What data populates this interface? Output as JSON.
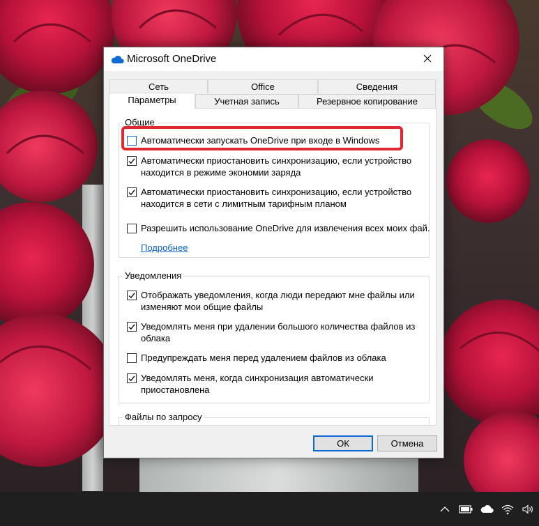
{
  "dialog": {
    "title": "Microsoft OneDrive",
    "tabs_back": [
      "Сеть",
      "Office",
      "Сведения"
    ],
    "tabs_front": [
      "Параметры",
      "Учетная запись",
      "Резервное копирование"
    ],
    "active_tab": "Параметры"
  },
  "general": {
    "label": "Общие",
    "options": [
      {
        "line1": "Автоматически запускать OneDrive при входе в Windows",
        "line2": "",
        "checked": false
      },
      {
        "line1": "Автоматически приостановить синхронизацию, если устройство",
        "line2": "находится в режиме экономии заряда",
        "checked": true
      },
      {
        "line1": "Автоматически приостановить синхронизацию, если устройство",
        "line2": "находится в сети с лимитным тарифным планом",
        "checked": true
      },
      {
        "line1": "Разрешить использование OneDrive для извлечения всех моих фай.",
        "line2": "",
        "checked": false
      }
    ],
    "more_link": "Подробнее"
  },
  "notifications": {
    "label": "Уведомления",
    "options": [
      {
        "line1": "Отображать уведомления, когда люди передают мне файлы или",
        "line2": "изменяют мои общие файлы",
        "checked": true
      },
      {
        "line1": "Уведомлять меня при удалении большого количества файлов из",
        "line2": "облака",
        "checked": true
      },
      {
        "line1": "Предупреждать меня перед удалением файлов из облака",
        "line2": "",
        "checked": false
      },
      {
        "line1": "Уведомлять меня, когда синхронизация автоматически",
        "line2": "приостановлена",
        "checked": true
      }
    ]
  },
  "files_on_demand": {
    "label": "Файлы по запросу"
  },
  "buttons": {
    "ok": "ОК",
    "cancel": "Отмена"
  },
  "icons": {
    "title": "onedrive-cloud-icon",
    "close": "close-icon",
    "tray": [
      "chevron-up-icon",
      "battery-icon",
      "onedrive-cloud-icon",
      "wifi-icon",
      "speaker-icon"
    ]
  },
  "colors": {
    "highlight": "#e0282e",
    "link": "#0a5fc9",
    "default_button_border": "#0a67d3",
    "onedrive_blue": "#0f6cd4"
  }
}
